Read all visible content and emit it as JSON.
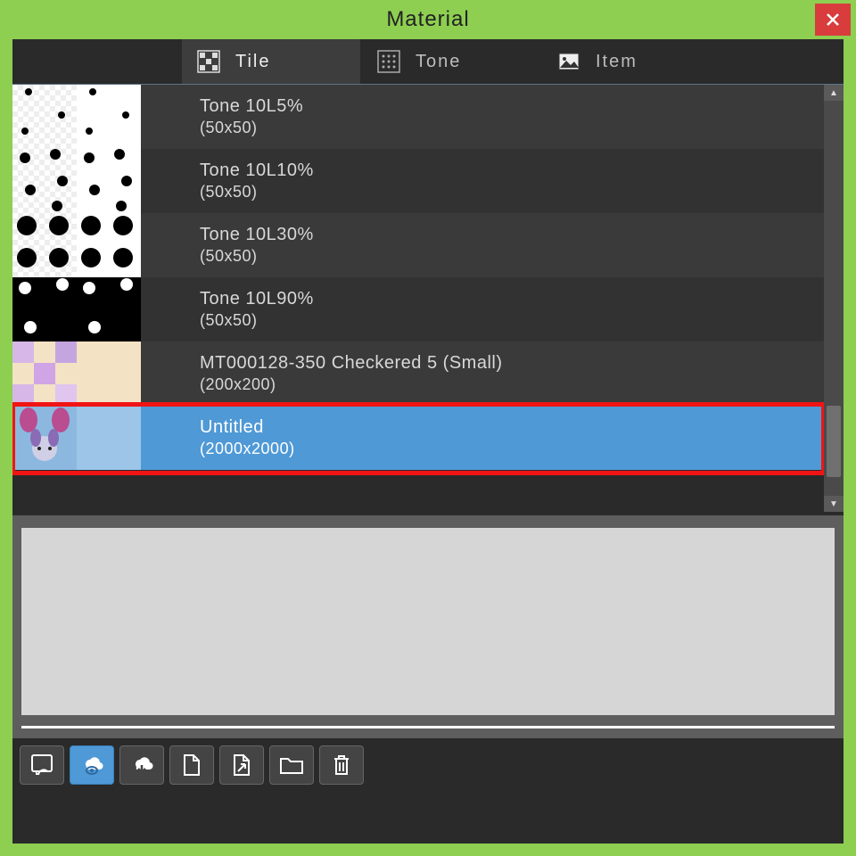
{
  "window": {
    "title": "Material"
  },
  "tabs": {
    "tile": "Tile",
    "tone": "Tone",
    "item": "Item",
    "active": "tile"
  },
  "items": [
    {
      "name": "Tone 10L5%",
      "dims": "(50x50)",
      "selected": false
    },
    {
      "name": "Tone 10L10%",
      "dims": "(50x50)",
      "selected": false
    },
    {
      "name": "Tone 10L30%",
      "dims": "(50x50)",
      "selected": false
    },
    {
      "name": "Tone 10L90%",
      "dims": "(50x50)",
      "selected": false
    },
    {
      "name": "MT000128-350 Checkered 5 (Small)",
      "dims": "(200x200)",
      "selected": false
    },
    {
      "name": "Untitled",
      "dims": "(2000x2000)",
      "selected": true
    }
  ],
  "highlight_index": 5,
  "colors": {
    "accent": "#4f99d6",
    "frame": "#8ecf51",
    "close": "#d83c3c",
    "highlight": "#f01414"
  }
}
